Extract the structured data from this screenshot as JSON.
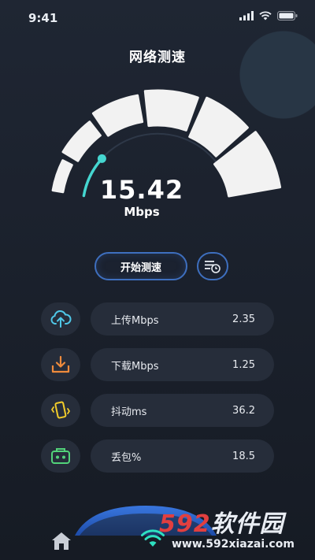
{
  "status_bar": {
    "time": "9:41"
  },
  "header": {
    "title": "网络测速"
  },
  "speed": {
    "value": "15.42",
    "unit": "Mbps",
    "gauge_level": 0.2
  },
  "actions": {
    "start_label": "开始测速"
  },
  "metrics": [
    {
      "label": "上传Mbps",
      "value": "2.35",
      "icon": "cloud-upload-icon",
      "color": "#4fc8e8"
    },
    {
      "label": "下载Mbps",
      "value": "1.25",
      "icon": "download-icon",
      "color": "#ef8b3c"
    },
    {
      "label": "抖动ms",
      "value": "36.2",
      "icon": "phone-vibrate-icon",
      "color": "#f2cc2a"
    },
    {
      "label": "丢包%",
      "value": "18.5",
      "icon": "packet-icon",
      "color": "#52d37a"
    }
  ],
  "watermark": {
    "brand_num": "592",
    "brand_text": "软件园",
    "url": "www.592xiazai.com"
  },
  "colors": {
    "accent": "#3e6fbf",
    "gauge_progress": "#45d6d0",
    "segment": "#f2f2f2"
  }
}
